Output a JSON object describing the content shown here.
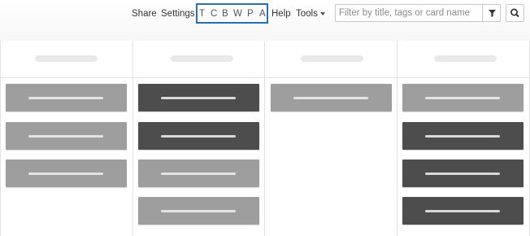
{
  "toolbar": {
    "share_label": "Share",
    "settings_label": "Settings",
    "help_label": "Help",
    "tools_label": "Tools",
    "view_buttons": [
      "T",
      "C",
      "B",
      "W",
      "P",
      "A"
    ]
  },
  "filter": {
    "value": "",
    "placeholder": "Filter by title, tags or card name"
  },
  "colors": {
    "accent": "#2a6fb4",
    "card_light": "#9e9e9e",
    "card_dark": "#4d4d4d"
  },
  "icons": [
    "filter-funnel-icon",
    "search-icon",
    "chevron-down-icon"
  ]
}
